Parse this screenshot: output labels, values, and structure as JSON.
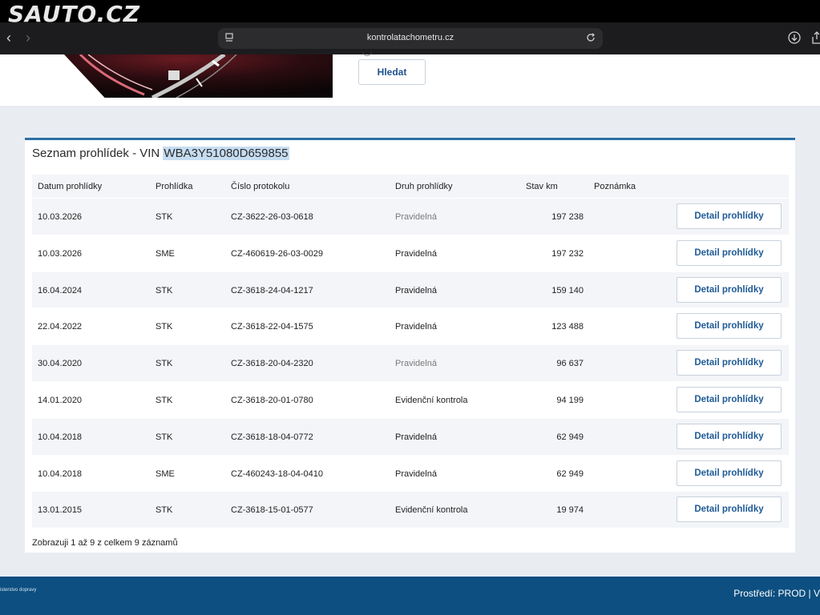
{
  "watermark": "SAUTO.CZ",
  "browser": {
    "url": "kontrolatachometru.cz"
  },
  "search": {
    "button_label": "Hledat"
  },
  "list": {
    "title_prefix": "Seznam prohlídek - VIN ",
    "vin": "WBA3Y51080D659855",
    "columns": [
      "Datum prohlídky",
      "Prohlídka",
      "Číslo protokolu",
      "Druh prohlídky",
      "Stav km",
      "Poznámka"
    ],
    "detail_label": "Detail prohlídky",
    "rows": [
      {
        "date": "10.03.2026",
        "type": "STK",
        "protocol": "CZ-3622-26-03-0618",
        "kind": "Pravidelná",
        "km": "197 238",
        "note": ""
      },
      {
        "date": "10.03.2026",
        "type": "SME",
        "protocol": "CZ-460619-26-03-0029",
        "kind": "Pravidelná",
        "km": "197 232",
        "note": ""
      },
      {
        "date": "16.04.2024",
        "type": "STK",
        "protocol": "CZ-3618-24-04-1217",
        "kind": "Pravidelná",
        "km": "159 140",
        "note": ""
      },
      {
        "date": "22.04.2022",
        "type": "STK",
        "protocol": "CZ-3618-22-04-1575",
        "kind": "Pravidelná",
        "km": "123 488",
        "note": ""
      },
      {
        "date": "30.04.2020",
        "type": "STK",
        "protocol": "CZ-3618-20-04-2320",
        "kind": "Pravidelná",
        "km": "96 637",
        "note": ""
      },
      {
        "date": "14.01.2020",
        "type": "STK",
        "protocol": "CZ-3618-20-01-0780",
        "kind": "Evidenční kontrola",
        "km": "94 199",
        "note": ""
      },
      {
        "date": "10.04.2018",
        "type": "STK",
        "protocol": "CZ-3618-18-04-0772",
        "kind": "Pravidelná",
        "km": "62 949",
        "note": ""
      },
      {
        "date": "10.04.2018",
        "type": "SME",
        "protocol": "CZ-460243-18-04-0410",
        "kind": "Pravidelná",
        "km": "62 949",
        "note": ""
      },
      {
        "date": "13.01.2015",
        "type": "STK",
        "protocol": "CZ-3618-15-01-0577",
        "kind": "Evidenční kontrola",
        "km": "19 974",
        "note": ""
      }
    ],
    "summary": "Zobrazuji 1 až 9 z celkem 9 záznamů"
  },
  "footer": {
    "left_text": "isterstvo dopravy",
    "right_text": "Prostředí: PROD | V"
  },
  "colors": {
    "accent": "#2d6fa7",
    "button_text": "#1f5a96",
    "footer_bg": "#0c4f80",
    "vin_highlight": "#c6ddf2"
  }
}
